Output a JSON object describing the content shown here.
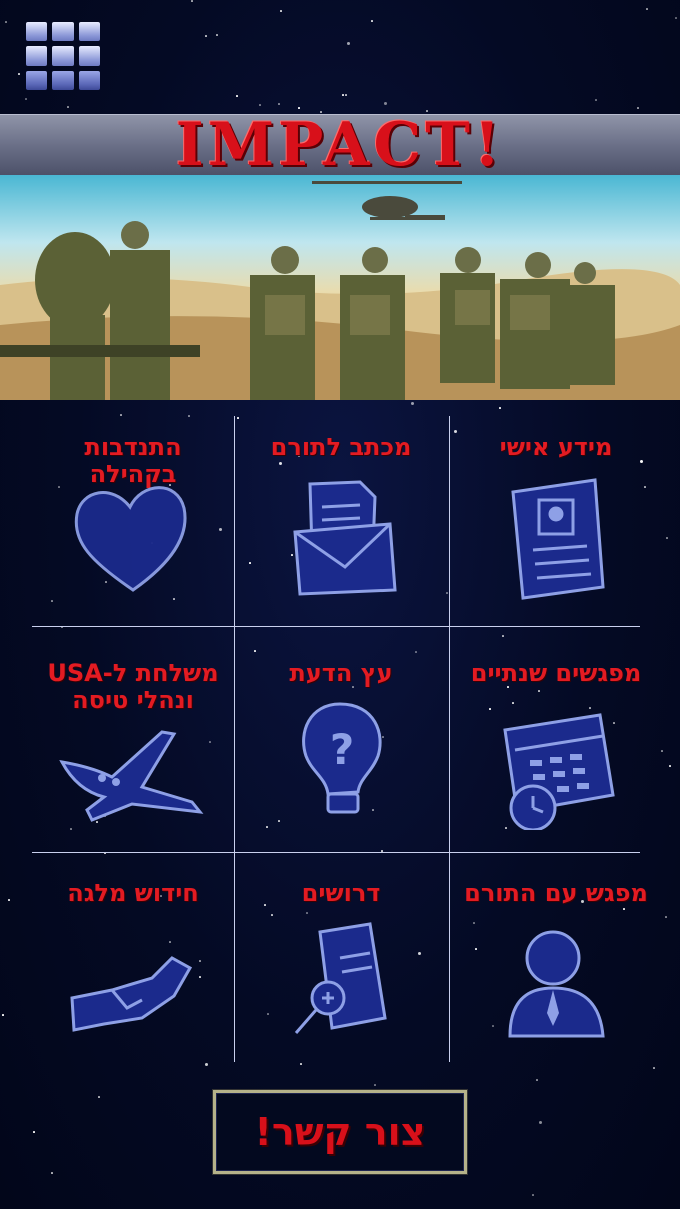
{
  "header": {
    "title": "IMPACT!",
    "menu_icon": "grid-menu-icon"
  },
  "hero": {
    "alt_icon": "soldiers-banner-image"
  },
  "tiles": [
    {
      "label": "התנדבות בקהילה",
      "icon": "heart-icon"
    },
    {
      "label": "מכתב לתורם",
      "icon": "envelope-letter-icon"
    },
    {
      "label": "מידע אישי",
      "icon": "profile-document-icon"
    },
    {
      "label": "משלחת ל-USA ונהלי טיסה",
      "icon": "airplane-icon"
    },
    {
      "label": "עץ הדעת",
      "icon": "lightbulb-question-icon"
    },
    {
      "label": "מפגשים שנתיים",
      "icon": "calendar-clock-icon"
    },
    {
      "label": "חידוש מלגה",
      "icon": "handshake-icon"
    },
    {
      "label": "דרושים",
      "icon": "document-search-icon"
    },
    {
      "label": "מפגש עם התורם",
      "icon": "person-icon"
    }
  ],
  "contact": {
    "label": "צור קשר!"
  },
  "colors": {
    "accent_red": "#e31b22",
    "icon_blue": "#1b2a8c",
    "background": "#040a24"
  }
}
